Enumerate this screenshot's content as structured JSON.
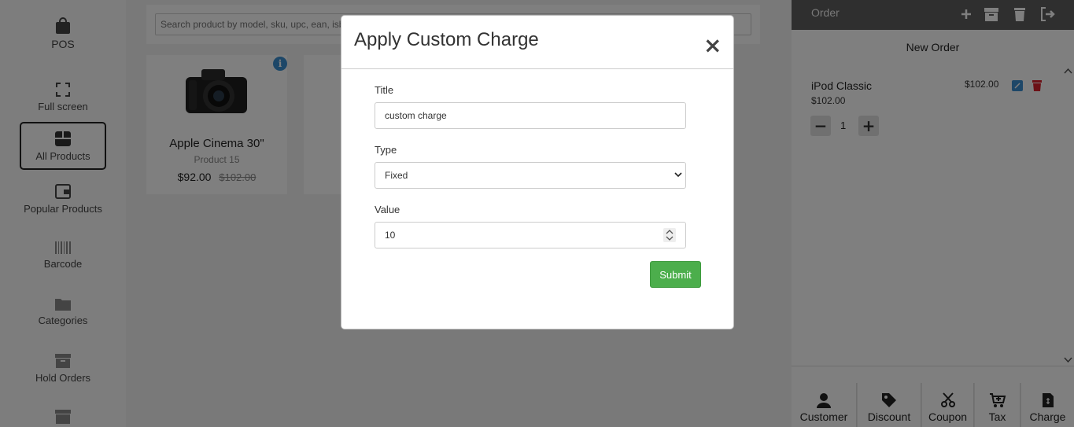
{
  "sidebar": {
    "items": [
      {
        "label": "POS",
        "icon": "bag-icon"
      },
      {
        "label": "Full screen",
        "icon": "expand-icon"
      },
      {
        "label": "All Products",
        "icon": "box-icon"
      },
      {
        "label": "Popular Products",
        "icon": "wallet-icon"
      },
      {
        "label": "Barcode",
        "icon": "barcode-icon"
      },
      {
        "label": "Categories",
        "icon": "folder-icon"
      },
      {
        "label": "Hold Orders",
        "icon": "archive-icon"
      }
    ]
  },
  "main": {
    "search": {
      "placeholder": "Search product by model, sku, upc, ean, isbn, mpn"
    },
    "products": [
      {
        "name": "Apple Cinema 30\"",
        "sub": "Product 15",
        "price": "$92.00",
        "old_price": "$102.00"
      }
    ]
  },
  "order": {
    "title": "Order",
    "new_order": "New Order",
    "item": {
      "name": "iPod Classic",
      "price": "$102.00",
      "line_total": "$102.00",
      "qty": "1"
    },
    "bottom": [
      {
        "label": "Customer",
        "icon": "user-icon"
      },
      {
        "label": "Discount",
        "icon": "tag-icon"
      },
      {
        "label": "Coupon",
        "icon": "scissors-icon"
      },
      {
        "label": "Tax",
        "icon": "cart-plus-icon"
      },
      {
        "label": "Charge",
        "icon": "receipt-icon"
      }
    ]
  },
  "modal": {
    "title": "Apply Custom Charge",
    "close": "×",
    "title_label": "Title",
    "title_value": "custom charge",
    "type_label": "Type",
    "type_value": "Fixed",
    "value_label": "Value",
    "value_value": "10",
    "submit": "Submit"
  },
  "colors": {
    "submit": "#4cae4c",
    "header": "#5e5e5e",
    "delete": "#d9232d",
    "edit": "#3b8fd0"
  }
}
